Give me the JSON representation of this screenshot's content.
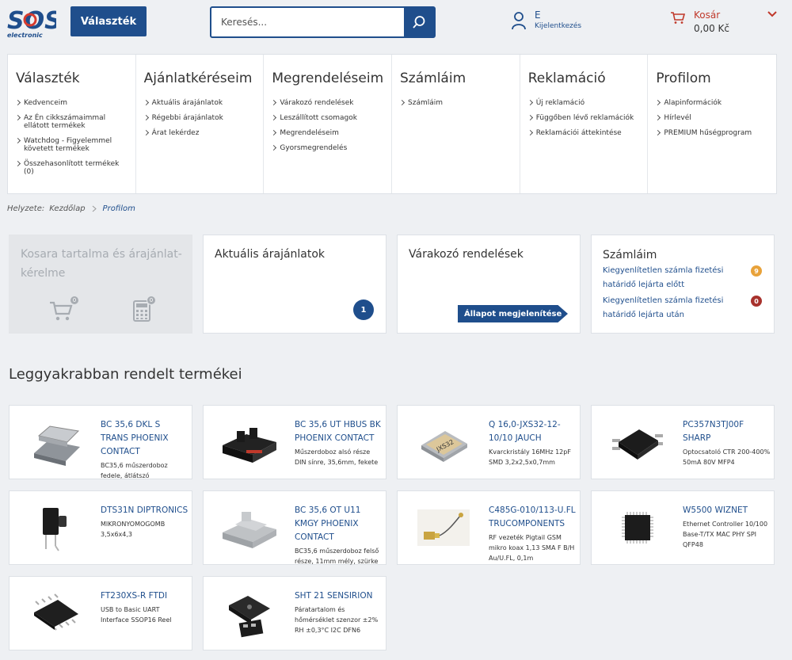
{
  "header": {
    "logo_text": "SOS",
    "logo_subtext": "electronic",
    "assortment_button": "Választék",
    "search_placeholder": "Keresés...",
    "user_name": "E",
    "user_login": "Kijelentkezés",
    "cart_label": "Kosár",
    "cart_amount": "0,00 Kč"
  },
  "menu": [
    {
      "title": "Választék",
      "items": [
        "Kedvenceim",
        "Az Én cikkszámaimmal ellátott termékek",
        "Watchdog - Figyelemmel követett termékek",
        "Összehasonlított termékek (0)"
      ]
    },
    {
      "title": "Ajánlatkéréseim",
      "items": [
        "Aktuális árajánlatok",
        "Régebbi árajánlatok",
        "Árat lekérdez"
      ]
    },
    {
      "title": "Megrendeléseim",
      "items": [
        "Várakozó rendelések",
        "Leszállított csomagok",
        "Megrendeléseim",
        "Gyorsmegrendelés"
      ]
    },
    {
      "title": "Számláim",
      "items": [
        "Számláim"
      ]
    },
    {
      "title": "Reklamáció",
      "items": [
        "Új reklamáció",
        "Függőben lévő reklamációk",
        "Reklamációi áttekintése"
      ]
    },
    {
      "title": "Profilom",
      "items": [
        "Alapinformációk",
        "Hírlevél",
        "PREMIUM hűségprogram"
      ]
    }
  ],
  "breadcrumb": {
    "prefix": "Helyzete:",
    "home": "Kezdőlap",
    "current": "Profilom"
  },
  "cards": {
    "cart_quotes": {
      "title": "Kosara tartalma és árajánlat-kérelme",
      "cart_count": "0",
      "quote_count": "0"
    },
    "current_quotes": {
      "title": "Aktuális árajánlatok",
      "count": "1"
    },
    "pending_orders": {
      "title": "Várakozó rendelések",
      "button": "Állapot megjelenítése"
    },
    "invoices": {
      "title": "Számláim",
      "rows": [
        {
          "text": "Kiegyenlítetlen számla fizetési határidő lejárta előtt",
          "count": "9",
          "color": "#e8a23a"
        },
        {
          "text": "Kiegyenlítetlen számla fizetési határidő lejárta után",
          "count": "0",
          "color": "#a8322d"
        }
      ]
    }
  },
  "products_title": "Leggyakrabban rendelt termékei",
  "products": [
    {
      "name": "BC 35,6 DKL S TRANS PHOENIX CONTACT",
      "desc": "BC35,6 műszerdoboz fedele, átlátszó",
      "icon": "enclosure-lid"
    },
    {
      "name": "BC 35,6 UT HBUS BK PHOENIX CONTACT",
      "desc": "Műszerdoboz alsó része DIN sínre, 35,6mm, fekete",
      "icon": "din-enclosure-black"
    },
    {
      "name": "Q 16,0-JXS32-12-10/10 JAUCH",
      "desc": "Kvarckristály 16MHz 12pF SMD 3,2x2,5x0,7mm",
      "icon": "crystal-oscillator"
    },
    {
      "name": "PC357N3TJ00F SHARP",
      "desc": "Optocsatoló CTR 200-400% 50mA 80V MFP4",
      "icon": "optocoupler-chip"
    },
    {
      "name": "DTS31N DIPTRONICS",
      "desc": "MIKRONYOMOGOMB 3,5x6x4,3",
      "icon": "tactile-switch"
    },
    {
      "name": "BC 35,6 OT U11 KMGY PHOENIX CONTACT",
      "desc": "BC35,6 műszerdoboz felső része, 11mm mély, szürke",
      "icon": "din-enclosure-grey"
    },
    {
      "name": "C485G-010/113-U.FL TRUCOMPONENTS",
      "desc": "RF vezeték Pigtail GSM mikro koax 1,13 SMA F B/H Au/U.FL, 0,1m",
      "icon": "rf-pigtail-cable"
    },
    {
      "name": "W5500 WIZNET",
      "desc": "Ethernet Controller 10/100 Base-T/TX MAC PHY SPI QFP48",
      "icon": "qfp-chip"
    },
    {
      "name": "FT230XS-R FTDI",
      "desc": "USB to Basic UART Interface SSOP16 Reel",
      "icon": "ssop-chip"
    },
    {
      "name": "SHT 21 SENSIRION",
      "desc": "Páratartalom és hőmérséklet szenzor ±2% RH ±0,3°C I2C DFN6",
      "icon": "dfn-sensor-chip"
    }
  ]
}
